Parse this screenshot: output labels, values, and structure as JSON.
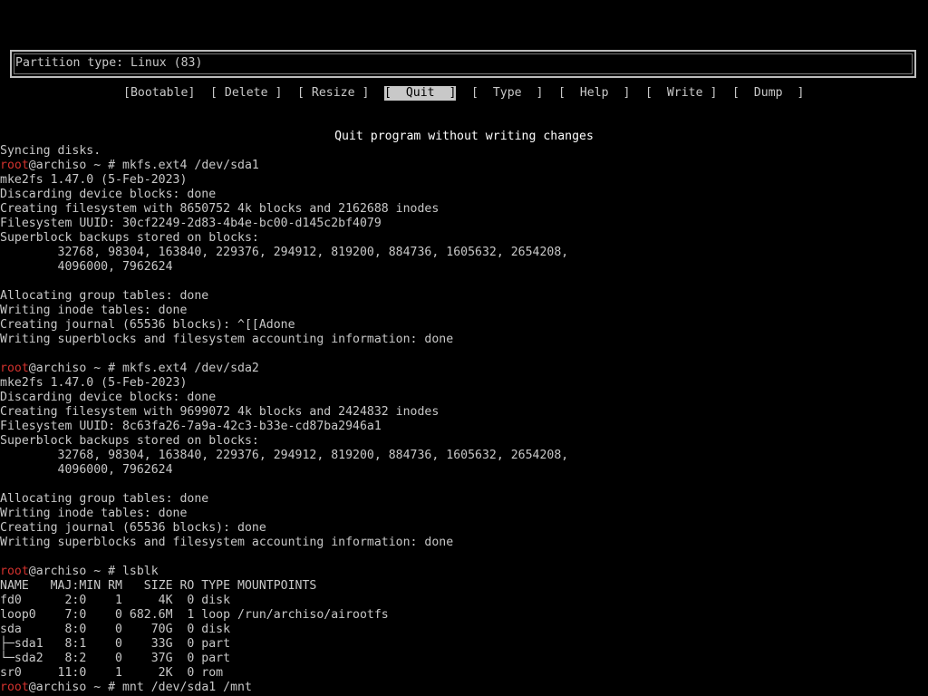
{
  "status_box": {
    "text": "Partition type: Linux (83)"
  },
  "menu": {
    "items": [
      {
        "label": "[Bootable]"
      },
      {
        "label": "[ Delete ]"
      },
      {
        "label": "[ Resize ]"
      },
      {
        "label": "[  Quit  ]",
        "selected": true
      },
      {
        "label": "[  Type  ]"
      },
      {
        "label": "[  Help  ]"
      },
      {
        "label": "[  Write ]"
      },
      {
        "label": "[  Dump  ]"
      }
    ]
  },
  "hint": "Quit program without writing changes",
  "colors": {
    "background": "#000000",
    "text": "#c8c8c8",
    "root_user": "#d3322e",
    "highlight": "#ffffff"
  },
  "console": {
    "lines": [
      {
        "text": "Syncing disks."
      },
      {
        "user": "root",
        "text": "@archiso ~ # mkfs.ext4 /dev/sda1"
      },
      {
        "text": "mke2fs 1.47.0 (5-Feb-2023)"
      },
      {
        "text": "Discarding device blocks: done"
      },
      {
        "text": "Creating filesystem with 8650752 4k blocks and 2162688 inodes"
      },
      {
        "text": "Filesystem UUID: 30cf2249-2d83-4b4e-bc00-d145c2bf4079"
      },
      {
        "text": "Superblock backups stored on blocks:"
      },
      {
        "text": "        32768, 98304, 163840, 229376, 294912, 819200, 884736, 1605632, 2654208,"
      },
      {
        "text": "        4096000, 7962624"
      },
      {
        "text": ""
      },
      {
        "text": "Allocating group tables: done"
      },
      {
        "text": "Writing inode tables: done"
      },
      {
        "text": "Creating journal (65536 blocks): ^[[Adone"
      },
      {
        "text": "Writing superblocks and filesystem accounting information: done"
      },
      {
        "text": ""
      },
      {
        "user": "root",
        "text": "@archiso ~ # mkfs.ext4 /dev/sda2"
      },
      {
        "text": "mke2fs 1.47.0 (5-Feb-2023)"
      },
      {
        "text": "Discarding device blocks: done"
      },
      {
        "text": "Creating filesystem with 9699072 4k blocks and 2424832 inodes"
      },
      {
        "text": "Filesystem UUID: 8c63fa26-7a9a-42c3-b33e-cd87ba2946a1"
      },
      {
        "text": "Superblock backups stored on blocks:"
      },
      {
        "text": "        32768, 98304, 163840, 229376, 294912, 819200, 884736, 1605632, 2654208,"
      },
      {
        "text": "        4096000, 7962624"
      },
      {
        "text": ""
      },
      {
        "text": "Allocating group tables: done"
      },
      {
        "text": "Writing inode tables: done"
      },
      {
        "text": "Creating journal (65536 blocks): done"
      },
      {
        "text": "Writing superblocks and filesystem accounting information: done"
      },
      {
        "text": ""
      },
      {
        "user": "root",
        "text": "@archiso ~ # lsblk"
      },
      {
        "text": "NAME   MAJ:MIN RM   SIZE RO TYPE MOUNTPOINTS"
      },
      {
        "text": "fd0      2:0    1     4K  0 disk"
      },
      {
        "text": "loop0    7:0    0 682.6M  1 loop /run/archiso/airootfs"
      },
      {
        "text": "sda      8:0    0    70G  0 disk"
      },
      {
        "text": "├─sda1   8:1    0    33G  0 part"
      },
      {
        "text": "└─sda2   8:2    0    37G  0 part"
      },
      {
        "text": "sr0     11:0    1     2K  0 rom"
      },
      {
        "user": "root",
        "text": "@archiso ~ # mnt /dev/sda1 /mnt"
      }
    ]
  }
}
